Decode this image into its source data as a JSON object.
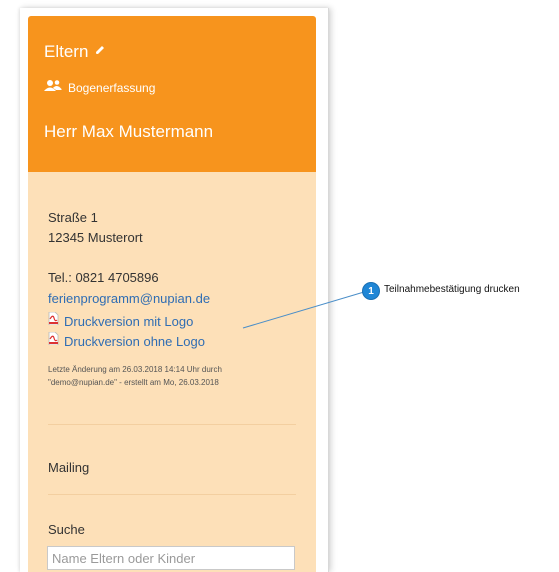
{
  "panel": {
    "title": "Eltern",
    "subtitle": "Bogenerfassung",
    "name": "Herr Max Mustermann"
  },
  "contact": {
    "street": "Straße 1",
    "city": "12345 Musterort",
    "phone": "Tel.: 0821 4705896",
    "email": "ferienprogramm@nupian.de",
    "print_with_logo": "Druckversion mit Logo",
    "print_without_logo": "Druckversion ohne Logo",
    "last_change_line1": "Letzte Änderung am 26.03.2018 14:14 Uhr durch",
    "last_change_line2": "\"demo@nupian.de\" - erstellt am Mo, 26.03.2018"
  },
  "mailing": {
    "label": "Mailing"
  },
  "search": {
    "label": "Suche",
    "placeholder": "Name Eltern oder Kinder"
  },
  "callout": {
    "number": "1",
    "text": "Teilnahmebestätigung drucken"
  },
  "icons": {
    "edit": "pencil-icon",
    "users": "users-icon",
    "pdf": "pdf-icon"
  },
  "colors": {
    "header": "#f7941d",
    "body": "#fde0b8",
    "link": "#2f6db3",
    "callout": "#1f86d6"
  }
}
